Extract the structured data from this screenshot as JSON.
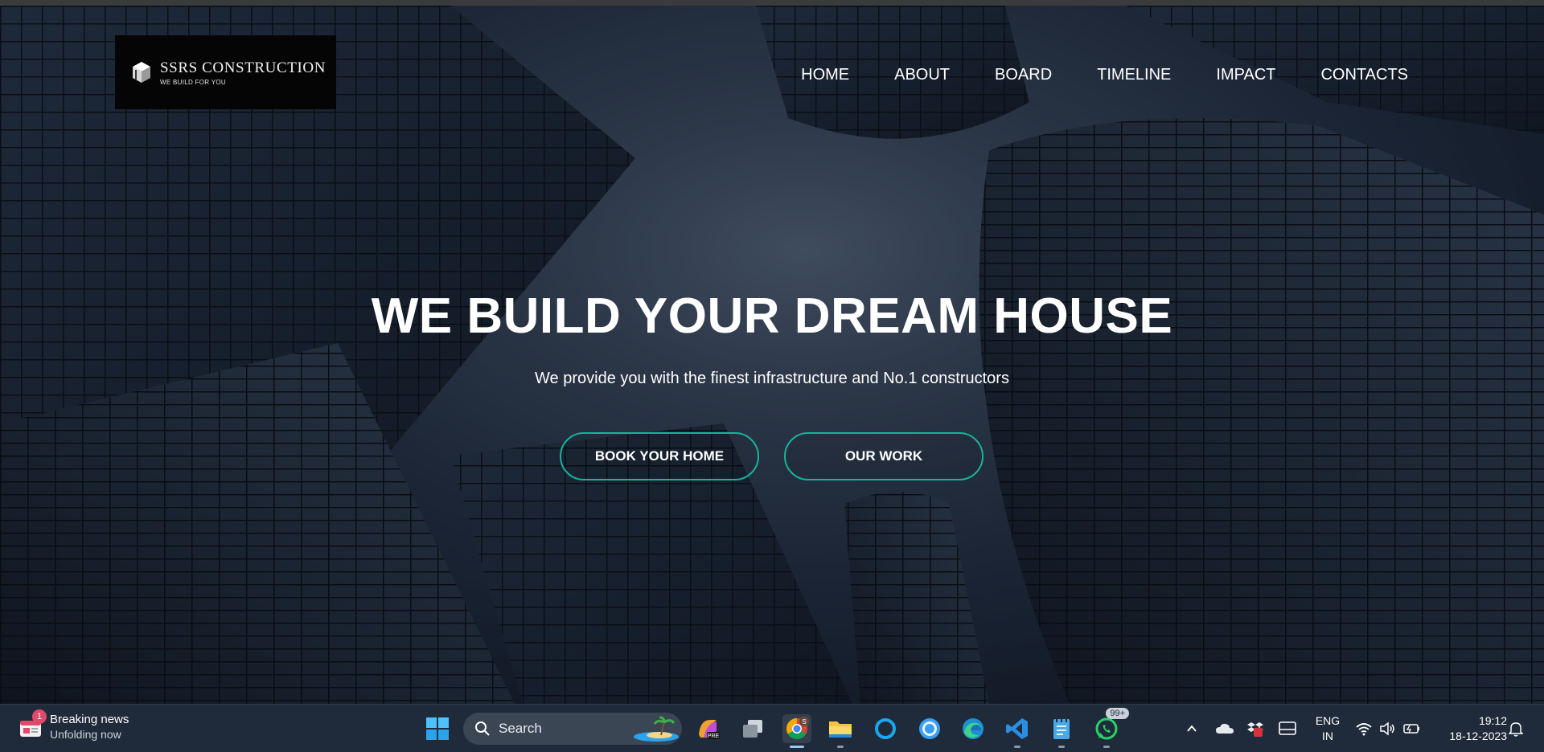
{
  "brand": {
    "name": "SSRS CONSTRUCTION",
    "tagline": "WE BUILD FOR YOU"
  },
  "nav": [
    "HOME",
    "ABOUT",
    "BOARD",
    "TIMELINE",
    "IMPACT",
    "CONTACTS"
  ],
  "hero": {
    "title": "WE BUILD YOUR DREAM HOUSE",
    "subtitle": "We provide you with the finest infrastructure and No.1 constructors",
    "primary_button": "BOOK YOUR HOME",
    "secondary_button": "OUR WORK",
    "accent_color": "#18b39a"
  },
  "taskbar": {
    "news": {
      "title": "Breaking news",
      "subtitle": "Unfolding now",
      "badge": "1"
    },
    "search_placeholder": "Search",
    "apps": [
      "windows-start-icon",
      "copilot-pre-icon",
      "task-view-icon",
      "chrome-icon",
      "file-explorer-icon",
      "cortana-icon",
      "circle-app-icon",
      "edge-icon",
      "vscode-icon",
      "notepad-icon",
      "whatsapp-icon"
    ],
    "chrome_profile": "S",
    "whatsapp_badge": "99+",
    "language": {
      "line1": "ENG",
      "line2": "IN"
    },
    "clock": {
      "time": "19:12",
      "date": "18-12-2023"
    }
  }
}
